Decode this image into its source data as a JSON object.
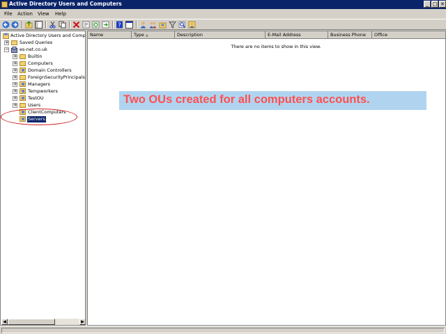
{
  "window": {
    "title": "Active Directory Users and Computers",
    "minimize": "_",
    "maximize": "□",
    "close": "✕"
  },
  "menu": [
    "File",
    "Action",
    "View",
    "Help"
  ],
  "tree": {
    "root": "Active Directory Users and Comput",
    "saved_queries": "Saved Queries",
    "domain": "es-net.co.uk",
    "children": [
      "Builtin",
      "Computers",
      "Domain Controllers",
      "ForeignSecurityPrincipals",
      "Managers",
      "Tempworkers",
      "TestOU",
      "Users",
      "ClientComputers",
      "Servers"
    ],
    "selected": "Servers"
  },
  "list": {
    "columns": [
      "Name",
      "Type",
      "Description",
      "E-Mail Address",
      "Business Phone",
      "Office"
    ],
    "sort_indicator": "▲",
    "empty_message": "There are no items to show in this view."
  },
  "annotation": {
    "text": "Two OUs created for all computers accounts.",
    "text_color": "#ff5050",
    "background": "#b0d4f0",
    "circle_color": "#d02020"
  },
  "colors": {
    "titlebar": "#0a246a",
    "selection": "#0a246a",
    "chrome": "#d4d0c8"
  }
}
